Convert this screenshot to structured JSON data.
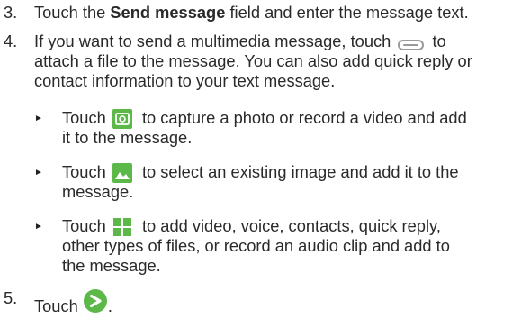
{
  "steps": [
    {
      "number": "3.",
      "pre": "Touch the ",
      "bold": "Send message",
      "post": " field and enter the message text."
    },
    {
      "number": "4.",
      "line1_pre": "If you want to send a multimedia message, touch ",
      "line1_post": " to",
      "line2": "attach a file to the message. You can also add quick reply or",
      "line3": "contact information to your text message.",
      "icon": "paperclip-icon"
    },
    {
      "number": "5.",
      "pre": "Touch ",
      "post": ".",
      "icon": "send-icon"
    }
  ],
  "bullets": [
    {
      "pre": "Touch ",
      "post": " to capture a photo or record a video and add",
      "line2": "it to the message.",
      "icon": "camera-icon"
    },
    {
      "pre": "Touch ",
      "post": " to select an existing image and add it to the",
      "line2": "message.",
      "icon": "gallery-icon"
    },
    {
      "pre": "Touch ",
      "post": " to add video, voice, contacts, quick reply,",
      "line2": "other types of files, or record an audio clip and add to",
      "line3": "the message.",
      "icon": "attachment-grid-icon"
    }
  ],
  "colors": {
    "icon_green": "#5db84a",
    "text": "#2a2a2a"
  }
}
